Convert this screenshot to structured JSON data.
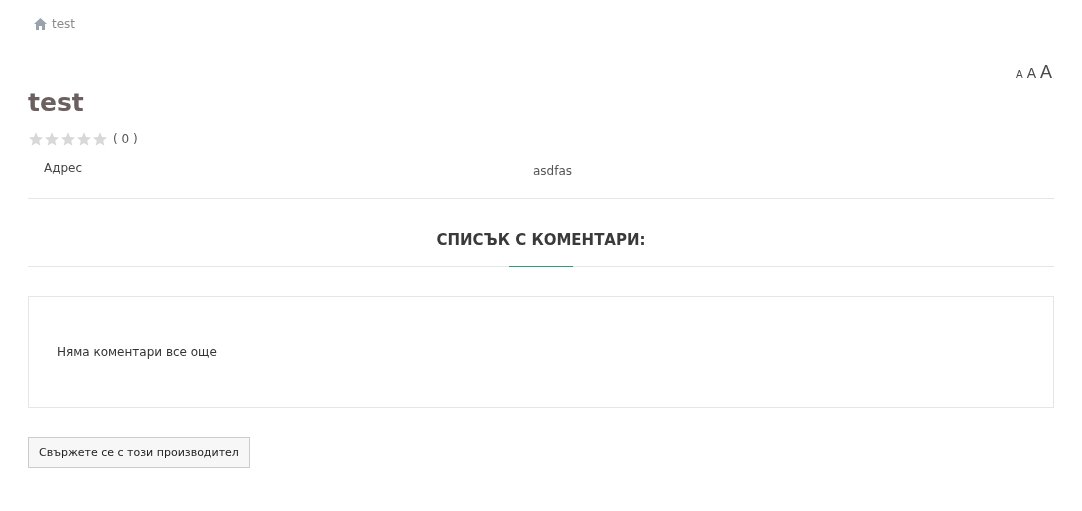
{
  "breadcrumb": [
    {
      "label": "test"
    }
  ],
  "font_sizes": [
    {
      "label": "A",
      "kind": "small"
    },
    {
      "label": "A",
      "kind": "medium"
    },
    {
      "label": "A",
      "kind": "large"
    }
  ],
  "title": "test",
  "rating": {
    "stars": 0,
    "count": "( 0 )"
  },
  "fields": [
    {
      "label": "Адрес",
      "value": "asdfas"
    }
  ],
  "comments": {
    "heading": "СПИСЪК С КОМЕНТАРИ:",
    "empty_text": "Няма коментари все още"
  },
  "contact_button": "Свържете се с този производител"
}
